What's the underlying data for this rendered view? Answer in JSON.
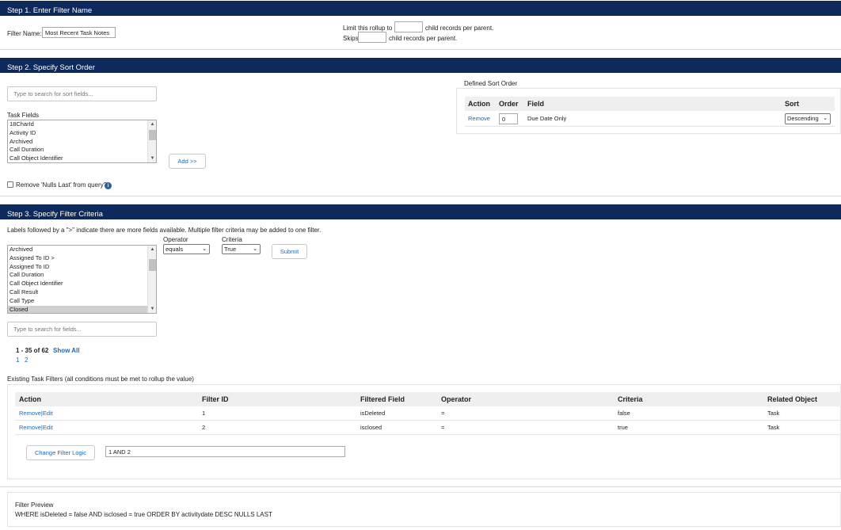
{
  "step1": {
    "title": "Step 1. Enter Filter Name",
    "filter_name_label": "Filter Name:",
    "filter_name_value": "Most Recent Task Notes",
    "limit_label": "Limit this rollup to",
    "limit_value": "",
    "limit_suffix": "child records per parent.",
    "skip_label": "Skips",
    "skip_value": "",
    "skip_suffix": "child records per parent."
  },
  "step2": {
    "title": "Step 2. Specify Sort Order",
    "search_placeholder": "Type to search for sort fields...",
    "fields_label": "Task Fields",
    "fields": [
      "18CharId",
      "Activity ID",
      "Archived",
      "Call Duration",
      "Call Object Identifier"
    ],
    "add_button": "Add >>",
    "nulls_last_label": "Remove 'Nulls Last' from query?",
    "nulls_last_checked": false,
    "defined_sort_label": "Defined Sort Order",
    "sort_table": {
      "headers": [
        "Action",
        "Order",
        "Field",
        "Sort"
      ],
      "rows": [
        {
          "action": "Remove",
          "order": "0",
          "field": "Due Date Only",
          "sort": "Descending"
        }
      ]
    }
  },
  "step3": {
    "title": "Step 3. Specify Filter Criteria",
    "help_text": "Labels followed by a \">\" indicate there are more fields available. Multiple filter criteria may be added to one filter.",
    "fields": [
      "Archived",
      "Assigned To ID >",
      "Assigned To ID",
      "Call Duration",
      "Call Object Identifier",
      "Call Result",
      "Call Type",
      "Closed"
    ],
    "selected_field": "Closed",
    "operator_label": "Operator",
    "operator_value": "equals",
    "criteria_label": "Criteria",
    "criteria_value": "True",
    "submit_button": "Submit",
    "search_placeholder": "Type to search for fields...",
    "pagination": {
      "range": "1 - 35 of 62",
      "show_all": "Show All",
      "pages": [
        "1",
        "2"
      ]
    },
    "existing_label": "Existing Task Filters (all conditions must be met to rollup the value)",
    "filters_table": {
      "headers": [
        "Action",
        "Filter ID",
        "Filtered Field",
        "Operator",
        "Criteria",
        "Related Object"
      ],
      "rows": [
        {
          "action": "Remove|Edit",
          "id": "1",
          "field": "isDeleted",
          "operator": "=",
          "criteria": "false",
          "object": "Task"
        },
        {
          "action": "Remove|Edit",
          "id": "2",
          "field": "isclosed",
          "operator": "=",
          "criteria": "true",
          "object": "Task"
        }
      ]
    },
    "change_logic_button": "Change Filter Logic",
    "logic_value": "1 AND 2"
  },
  "preview": {
    "label": "Filter Preview",
    "query": "WHERE isDeleted = false AND isclosed = true ORDER BY activitydate DESC NULLS LAST"
  },
  "colors": {
    "header_bg": "#0e2a5c",
    "link": "#1a6bb8"
  }
}
